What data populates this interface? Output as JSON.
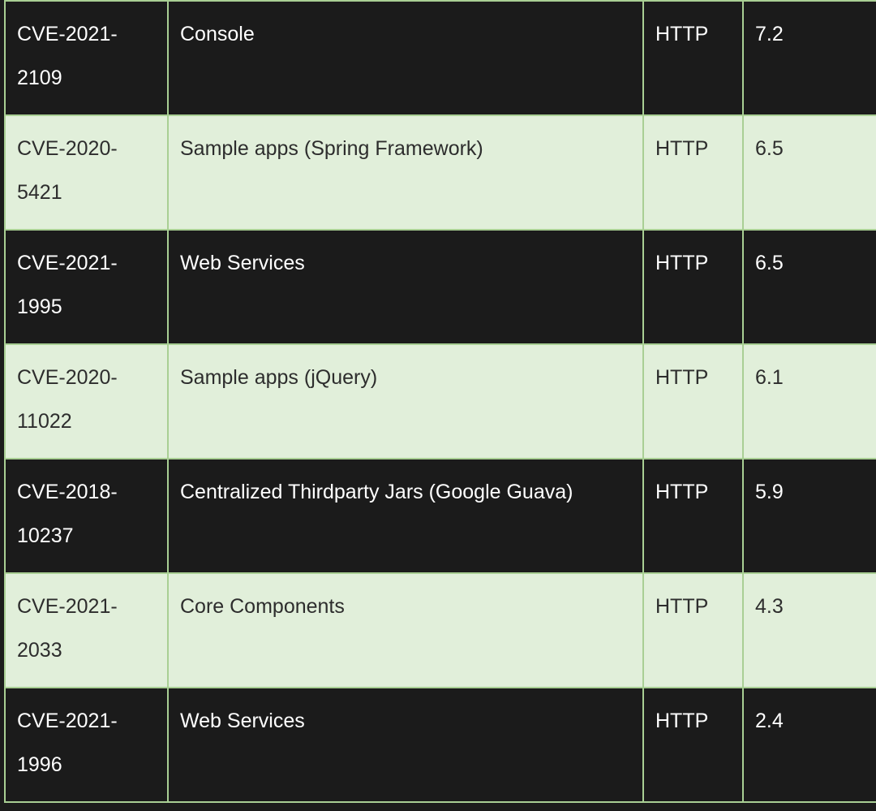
{
  "table": {
    "rows": [
      {
        "cve": "CVE-2021-\n2109",
        "component": "Console",
        "protocol": "HTTP",
        "score": "7.2",
        "theme": "dark"
      },
      {
        "cve": "CVE-2020-\n5421",
        "component": "Sample apps (Spring Framework)",
        "protocol": "HTTP",
        "score": "6.5",
        "theme": "light"
      },
      {
        "cve": "CVE-2021-\n1995",
        "component": "Web Services",
        "protocol": "HTTP",
        "score": "6.5",
        "theme": "dark"
      },
      {
        "cve": "CVE-2020-\n11022",
        "component": "Sample apps (jQuery)",
        "protocol": "HTTP",
        "score": "6.1",
        "theme": "light"
      },
      {
        "cve": "CVE-2018-\n10237",
        "component": "Centralized Thirdparty Jars (Google Guava)",
        "protocol": "HTTP",
        "score": "5.9",
        "theme": "dark"
      },
      {
        "cve": "CVE-2021-\n2033",
        "component": "Core Components",
        "protocol": "HTTP",
        "score": "4.3",
        "theme": "light"
      },
      {
        "cve": "CVE-2021-\n1996",
        "component": "Web Services",
        "protocol": "HTTP",
        "score": "2.4",
        "theme": "dark"
      }
    ]
  }
}
